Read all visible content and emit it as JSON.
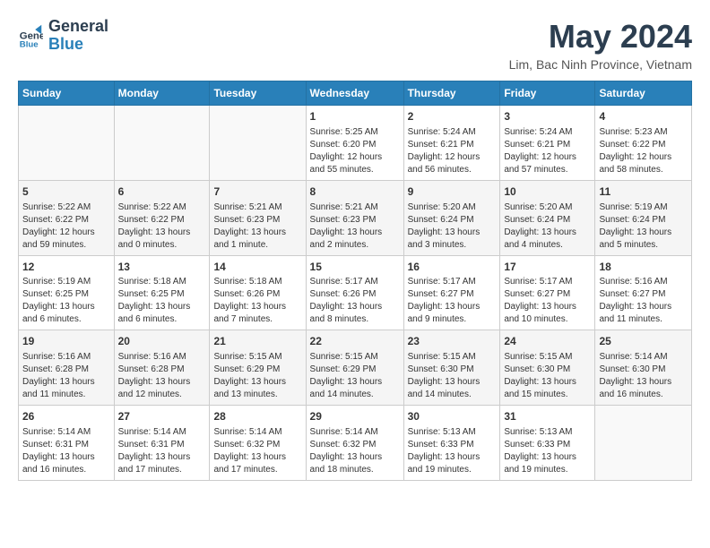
{
  "logo": {
    "line1": "General",
    "line2": "Blue"
  },
  "title": "May 2024",
  "location": "Lim, Bac Ninh Province, Vietnam",
  "days_of_week": [
    "Sunday",
    "Monday",
    "Tuesday",
    "Wednesday",
    "Thursday",
    "Friday",
    "Saturday"
  ],
  "weeks": [
    [
      {
        "day": "",
        "info": ""
      },
      {
        "day": "",
        "info": ""
      },
      {
        "day": "",
        "info": ""
      },
      {
        "day": "1",
        "info": "Sunrise: 5:25 AM\nSunset: 6:20 PM\nDaylight: 12 hours and 55 minutes."
      },
      {
        "day": "2",
        "info": "Sunrise: 5:24 AM\nSunset: 6:21 PM\nDaylight: 12 hours and 56 minutes."
      },
      {
        "day": "3",
        "info": "Sunrise: 5:24 AM\nSunset: 6:21 PM\nDaylight: 12 hours and 57 minutes."
      },
      {
        "day": "4",
        "info": "Sunrise: 5:23 AM\nSunset: 6:22 PM\nDaylight: 12 hours and 58 minutes."
      }
    ],
    [
      {
        "day": "5",
        "info": "Sunrise: 5:22 AM\nSunset: 6:22 PM\nDaylight: 12 hours and 59 minutes."
      },
      {
        "day": "6",
        "info": "Sunrise: 5:22 AM\nSunset: 6:22 PM\nDaylight: 13 hours and 0 minutes."
      },
      {
        "day": "7",
        "info": "Sunrise: 5:21 AM\nSunset: 6:23 PM\nDaylight: 13 hours and 1 minute."
      },
      {
        "day": "8",
        "info": "Sunrise: 5:21 AM\nSunset: 6:23 PM\nDaylight: 13 hours and 2 minutes."
      },
      {
        "day": "9",
        "info": "Sunrise: 5:20 AM\nSunset: 6:24 PM\nDaylight: 13 hours and 3 minutes."
      },
      {
        "day": "10",
        "info": "Sunrise: 5:20 AM\nSunset: 6:24 PM\nDaylight: 13 hours and 4 minutes."
      },
      {
        "day": "11",
        "info": "Sunrise: 5:19 AM\nSunset: 6:24 PM\nDaylight: 13 hours and 5 minutes."
      }
    ],
    [
      {
        "day": "12",
        "info": "Sunrise: 5:19 AM\nSunset: 6:25 PM\nDaylight: 13 hours and 6 minutes."
      },
      {
        "day": "13",
        "info": "Sunrise: 5:18 AM\nSunset: 6:25 PM\nDaylight: 13 hours and 6 minutes."
      },
      {
        "day": "14",
        "info": "Sunrise: 5:18 AM\nSunset: 6:26 PM\nDaylight: 13 hours and 7 minutes."
      },
      {
        "day": "15",
        "info": "Sunrise: 5:17 AM\nSunset: 6:26 PM\nDaylight: 13 hours and 8 minutes."
      },
      {
        "day": "16",
        "info": "Sunrise: 5:17 AM\nSunset: 6:27 PM\nDaylight: 13 hours and 9 minutes."
      },
      {
        "day": "17",
        "info": "Sunrise: 5:17 AM\nSunset: 6:27 PM\nDaylight: 13 hours and 10 minutes."
      },
      {
        "day": "18",
        "info": "Sunrise: 5:16 AM\nSunset: 6:27 PM\nDaylight: 13 hours and 11 minutes."
      }
    ],
    [
      {
        "day": "19",
        "info": "Sunrise: 5:16 AM\nSunset: 6:28 PM\nDaylight: 13 hours and 11 minutes."
      },
      {
        "day": "20",
        "info": "Sunrise: 5:16 AM\nSunset: 6:28 PM\nDaylight: 13 hours and 12 minutes."
      },
      {
        "day": "21",
        "info": "Sunrise: 5:15 AM\nSunset: 6:29 PM\nDaylight: 13 hours and 13 minutes."
      },
      {
        "day": "22",
        "info": "Sunrise: 5:15 AM\nSunset: 6:29 PM\nDaylight: 13 hours and 14 minutes."
      },
      {
        "day": "23",
        "info": "Sunrise: 5:15 AM\nSunset: 6:30 PM\nDaylight: 13 hours and 14 minutes."
      },
      {
        "day": "24",
        "info": "Sunrise: 5:15 AM\nSunset: 6:30 PM\nDaylight: 13 hours and 15 minutes."
      },
      {
        "day": "25",
        "info": "Sunrise: 5:14 AM\nSunset: 6:30 PM\nDaylight: 13 hours and 16 minutes."
      }
    ],
    [
      {
        "day": "26",
        "info": "Sunrise: 5:14 AM\nSunset: 6:31 PM\nDaylight: 13 hours and 16 minutes."
      },
      {
        "day": "27",
        "info": "Sunrise: 5:14 AM\nSunset: 6:31 PM\nDaylight: 13 hours and 17 minutes."
      },
      {
        "day": "28",
        "info": "Sunrise: 5:14 AM\nSunset: 6:32 PM\nDaylight: 13 hours and 17 minutes."
      },
      {
        "day": "29",
        "info": "Sunrise: 5:14 AM\nSunset: 6:32 PM\nDaylight: 13 hours and 18 minutes."
      },
      {
        "day": "30",
        "info": "Sunrise: 5:13 AM\nSunset: 6:33 PM\nDaylight: 13 hours and 19 minutes."
      },
      {
        "day": "31",
        "info": "Sunrise: 5:13 AM\nSunset: 6:33 PM\nDaylight: 13 hours and 19 minutes."
      },
      {
        "day": "",
        "info": ""
      }
    ]
  ]
}
